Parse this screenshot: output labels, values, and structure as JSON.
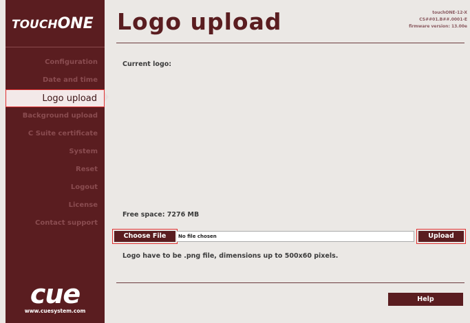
{
  "brand": {
    "prefix": "TOUCH",
    "suffix": "ONE"
  },
  "header": {
    "title": "Logo upload",
    "device_info": [
      "touchONE-12-X",
      "CS##01.B##.0001-E",
      "firmware version: 13.00e"
    ]
  },
  "sidebar": {
    "items": [
      {
        "label": "Configuration",
        "active": false
      },
      {
        "label": "Date and time",
        "active": false
      },
      {
        "label": "Logo upload",
        "active": true
      },
      {
        "label": "Background upload",
        "active": false
      },
      {
        "label": "C Suite certificate",
        "active": false
      },
      {
        "label": "System",
        "active": false
      },
      {
        "label": "Reset",
        "active": false
      },
      {
        "label": "Logout",
        "active": false
      },
      {
        "label": "License",
        "active": false
      },
      {
        "label": "Contact support",
        "active": false
      }
    ],
    "footer_logo": "cue",
    "footer_url": "www.cuesystem.com"
  },
  "main": {
    "current_logo_label": "Current logo:",
    "free_space": "Free space: 7276 MB",
    "choose_file_label": "Choose File",
    "file_name": "No file chosen",
    "upload_label": "Upload",
    "hint": "Logo have to be .png file, dimensions up to 500x60 pixels.",
    "help_label": "Help"
  },
  "colors": {
    "brand": "#5a1d20",
    "background": "#ebe8e5",
    "highlight": "#e03030"
  }
}
